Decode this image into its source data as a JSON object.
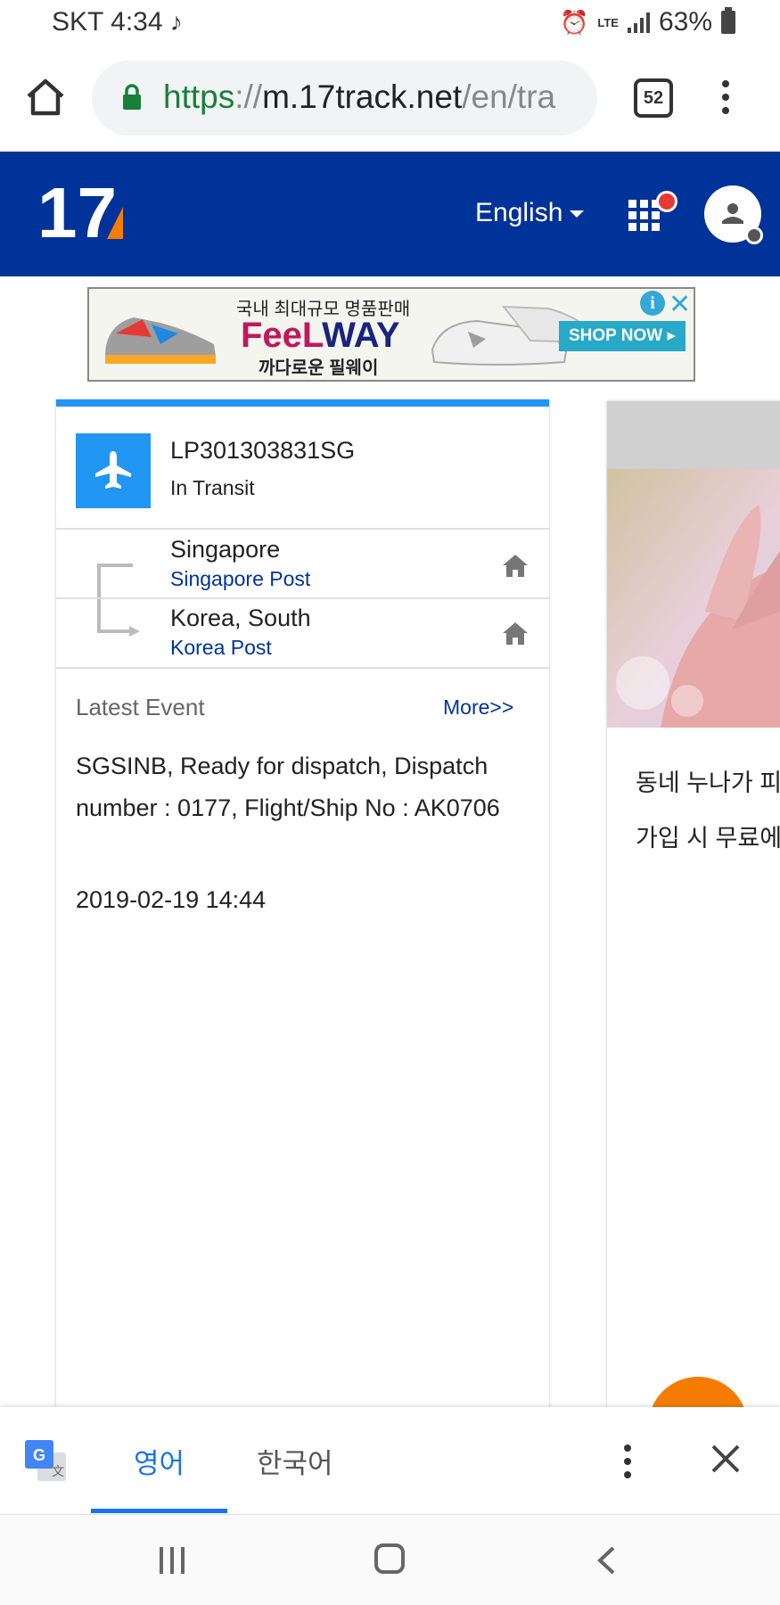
{
  "status_bar": {
    "carrier_time": "SKT 4:34",
    "music_icon": "music-note-icon",
    "network": "LTE",
    "battery": "63%"
  },
  "browser": {
    "url_scheme": "https",
    "url_sep": "://",
    "url_host": "m.17track.net",
    "url_path": "/en/tra",
    "tab_count": "52"
  },
  "header": {
    "logo": "17",
    "language": "English",
    "colors": {
      "brand": "#003399",
      "accent": "#f57c00"
    }
  },
  "ad": {
    "top_text": "국내 최대규모 명품판매",
    "brand_a": "FeeL",
    "brand_b": "WAY",
    "sub_text": "까다로운 필웨이",
    "cta": "SHOP NOW ▸",
    "info_icon": "i",
    "close_icon": "✕"
  },
  "shipment": {
    "tracking_number": "LP301303831SG",
    "status": "In Transit",
    "origin": {
      "country": "Singapore",
      "carrier": "Singapore Post"
    },
    "destination": {
      "country": "Korea, South",
      "carrier": "Korea Post"
    },
    "latest_event_label": "Latest Event",
    "more_label": "More>>",
    "event_description": "SGSINB, Ready for dispatch, Dispatch number : 0177, Flight/Ship No : AK0706",
    "event_time": "2019-02-19 14:44"
  },
  "side_ad": {
    "line1": "동네 누나가 피",
    "line2": "가입 시 무료에"
  },
  "translate_bar": {
    "tab_source": "영어",
    "tab_target": "한국어"
  }
}
